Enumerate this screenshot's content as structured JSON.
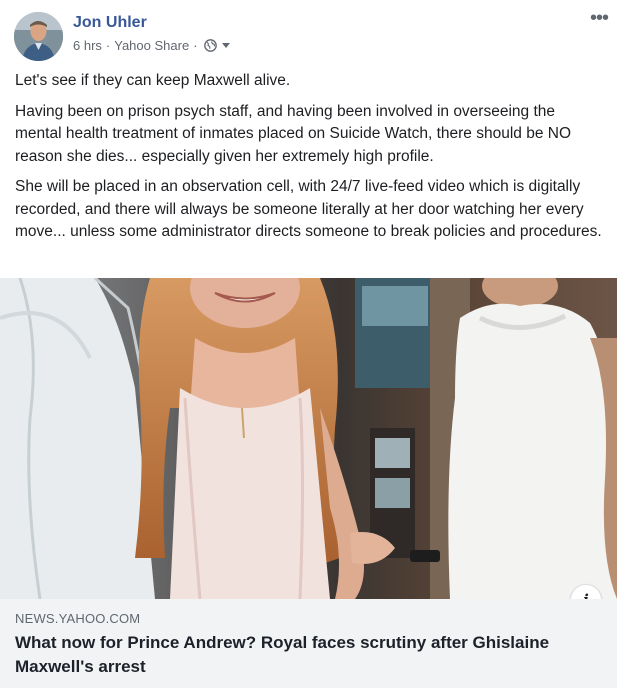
{
  "post": {
    "author": "Jon Uhler",
    "time": "6 hrs",
    "source": "Yahoo Share",
    "separator": "·",
    "privacy_icon": "globe-icon",
    "menu_icon": "more-horizontal-icon",
    "paragraphs": [
      "Let's see if they can keep Maxwell alive.",
      "Having been on prison psych staff, and having been involved in overseeing the mental health treatment of inmates placed on Suicide Watch, there should be NO reason she dies... especially given her extremely high profile.",
      "She will be placed in an observation cell, with 24/7 live-feed video which is digitally recorded, and there will always be someone literally at her door watching her every move... unless some administrator directs someone to break policies and procedures."
    ]
  },
  "link": {
    "domain": "NEWS.YAHOO.COM",
    "title": "What now for Prince Andrew? Royal faces scrutiny after Ghislaine Maxwell's arrest",
    "info_label": "i"
  },
  "colors": {
    "author_blue": "#385898",
    "meta_gray": "#616770",
    "caption_bg": "#f2f3f5"
  }
}
